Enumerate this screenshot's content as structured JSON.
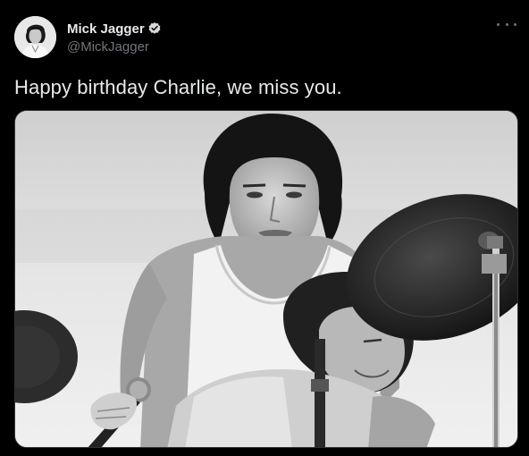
{
  "tweet": {
    "author": {
      "display_name": "Mick Jagger",
      "handle": "@MickJagger",
      "verified": true,
      "avatar_icon": "avatar-photo"
    },
    "more_icon": "more-options-icon",
    "text": "Happy birthday Charlie, we miss you.",
    "media": {
      "type": "black-and-white photograph",
      "content": [
        "Mick Jagger",
        "Charlie Watts at drum kit",
        "cymbals",
        "microphone"
      ]
    }
  },
  "colors": {
    "background": "#000000",
    "primary_text": "#e7e9ea",
    "secondary_text": "#71767b",
    "verified_badge": "#d9d9d9"
  }
}
